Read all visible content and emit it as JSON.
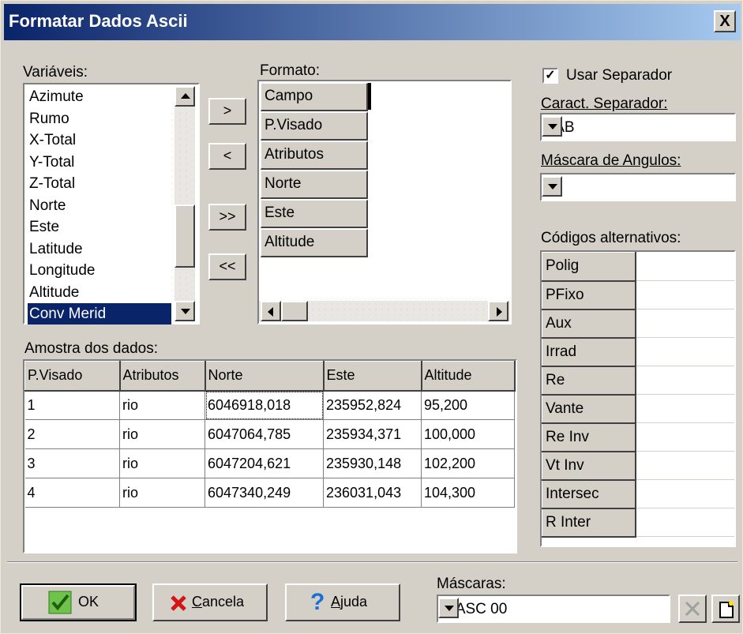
{
  "window": {
    "title": "Formatar Dados Ascii",
    "close_glyph": "X"
  },
  "variaveis": {
    "label": "Variáveis:",
    "items": [
      "Azimute",
      "Rumo",
      "X-Total",
      "Y-Total",
      "Z-Total",
      "Norte",
      "Este",
      "Latitude",
      "Longitude",
      "Altitude",
      "Conv Merid"
    ],
    "selected": "Conv Merid"
  },
  "move_buttons": [
    ">",
    "<",
    ">>",
    "<<"
  ],
  "formato": {
    "label": "Formato:",
    "fields": [
      "Campo",
      "P.Visado",
      "Atributos",
      "Norte",
      "Este",
      "Altitude"
    ]
  },
  "separator": {
    "use_label": "Usar Separador",
    "use_checked": true,
    "check_glyph": "✓",
    "char_label": "Caract. Separador:",
    "char_value": "TAB"
  },
  "angle_mask": {
    "label": "Máscara de Angulos:",
    "value": ""
  },
  "alt_codes": {
    "label": "Códigos alternativos:",
    "codes": [
      "Polig",
      "PFixo",
      "Aux",
      "Irrad",
      "Re",
      "Vante",
      "Re Inv",
      "Vt Inv",
      "Intersec",
      "R Inter"
    ]
  },
  "sample": {
    "label": "Amostra dos dados:",
    "columns": [
      "P.Visado",
      "Atributos",
      "Norte",
      "Este",
      "Altitude"
    ],
    "rows": [
      [
        "1",
        "rio",
        "6046918,018",
        "235952,824",
        "95,200"
      ],
      [
        "2",
        "rio",
        "6047064,785",
        "235934,371",
        "100,000"
      ],
      [
        "3",
        "rio",
        "6047204,621",
        "235930,148",
        "102,200"
      ],
      [
        "4",
        "rio",
        "6047340,249",
        "236031,043",
        "104,300"
      ]
    ]
  },
  "footer": {
    "ok_label": "OK",
    "cancel_label": "Cancela",
    "cancel_underline": "C",
    "cancel_rest": "ancela",
    "help_label": "Ajuda",
    "help_underline": "A",
    "help_rest": "juda",
    "masks_label": "Máscaras:",
    "mask_value": "MASC 00"
  },
  "colors": {
    "title_start": "#0a246a",
    "title_end": "#a6caf0",
    "selection": "#0a246a",
    "face": "#d4d0c8"
  },
  "icons": [
    "ok-check-icon",
    "cancel-x-icon",
    "help-question-icon",
    "delete-x-icon",
    "new-document-icon"
  ]
}
